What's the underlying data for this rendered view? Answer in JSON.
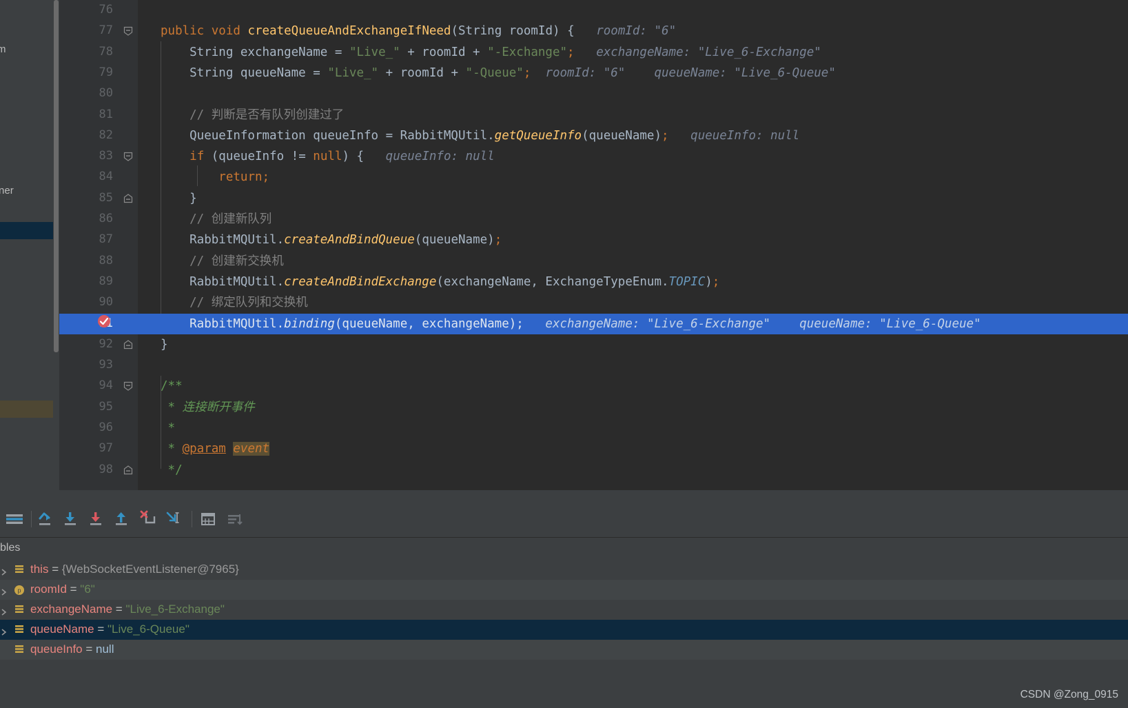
{
  "editor": {
    "first_line": 76,
    "lines": [
      {
        "num": 76,
        "tokens": [],
        "fold": null
      },
      {
        "num": 77,
        "fold": "minus",
        "tokens": [
          {
            "t": "public ",
            "c": "kw"
          },
          {
            "t": "void ",
            "c": "kw"
          },
          {
            "t": "createQueueAndExchangeIfNeed",
            "c": "fn"
          },
          {
            "t": "(",
            "c": "id"
          },
          {
            "t": "String",
            "c": "id"
          },
          {
            "t": " roomId",
            "c": "id"
          },
          {
            "t": ") {",
            "c": "id"
          },
          {
            "t": "   roomId: \"6\"",
            "c": "hint"
          }
        ]
      },
      {
        "num": 78,
        "fold": null,
        "tokens": [
          {
            "t": "    String exchangeName = ",
            "c": "id"
          },
          {
            "t": "\"Live_\"",
            "c": "str"
          },
          {
            "t": " + roomId + ",
            "c": "id"
          },
          {
            "t": "\"-Exchange\"",
            "c": "str"
          },
          {
            "t": ";",
            "c": "kw"
          },
          {
            "t": "   exchangeName: \"Live_6-Exchange\"",
            "c": "hint"
          }
        ]
      },
      {
        "num": 79,
        "fold": null,
        "tokens": [
          {
            "t": "    String queueName = ",
            "c": "id"
          },
          {
            "t": "\"Live_\"",
            "c": "str"
          },
          {
            "t": " + roomId + ",
            "c": "id"
          },
          {
            "t": "\"-Queue\"",
            "c": "str"
          },
          {
            "t": ";",
            "c": "kw"
          },
          {
            "t": "  roomId: \"6\"    queueName: \"Live_6-Queue\"",
            "c": "hint"
          }
        ]
      },
      {
        "num": 80,
        "fold": null,
        "tokens": []
      },
      {
        "num": 81,
        "fold": null,
        "tokens": [
          {
            "t": "    // 判断是否有队列创建过了",
            "c": "com"
          }
        ]
      },
      {
        "num": 82,
        "fold": null,
        "tokens": [
          {
            "t": "    QueueInformation queueInfo = RabbitMQUtil.",
            "c": "id"
          },
          {
            "t": "getQueueInfo",
            "c": "fn it"
          },
          {
            "t": "(queueName)",
            "c": "id"
          },
          {
            "t": ";",
            "c": "kw"
          },
          {
            "t": "   queueInfo: null",
            "c": "hint"
          }
        ]
      },
      {
        "num": 83,
        "fold": "minus",
        "tokens": [
          {
            "t": "    ",
            "c": "id"
          },
          {
            "t": "if",
            "c": "kw"
          },
          {
            "t": " (queueInfo != ",
            "c": "id"
          },
          {
            "t": "null",
            "c": "kw"
          },
          {
            "t": ") {",
            "c": "id"
          },
          {
            "t": "   queueInfo: null",
            "c": "hint"
          }
        ]
      },
      {
        "num": 84,
        "fold": null,
        "tokens": [
          {
            "t": "        ",
            "c": "id"
          },
          {
            "t": "return",
            "c": "kw"
          },
          {
            "t": ";",
            "c": "kw"
          }
        ]
      },
      {
        "num": 85,
        "fold": "angle",
        "tokens": [
          {
            "t": "    }",
            "c": "id"
          }
        ]
      },
      {
        "num": 86,
        "fold": null,
        "tokens": [
          {
            "t": "    // 创建新队列",
            "c": "com"
          }
        ]
      },
      {
        "num": 87,
        "fold": null,
        "tokens": [
          {
            "t": "    RabbitMQUtil.",
            "c": "id"
          },
          {
            "t": "createAndBindQueue",
            "c": "fn it"
          },
          {
            "t": "(queueName)",
            "c": "id"
          },
          {
            "t": ";",
            "c": "kw"
          }
        ]
      },
      {
        "num": 88,
        "fold": null,
        "tokens": [
          {
            "t": "    // 创建新交换机",
            "c": "com"
          }
        ]
      },
      {
        "num": 89,
        "fold": null,
        "tokens": [
          {
            "t": "    RabbitMQUtil.",
            "c": "id"
          },
          {
            "t": "createAndBindExchange",
            "c": "fn it"
          },
          {
            "t": "(exchangeName, ExchangeTypeEnum.",
            "c": "id"
          },
          {
            "t": "TOPIC",
            "c": "num it"
          },
          {
            "t": ")",
            "c": "id"
          },
          {
            "t": ";",
            "c": "kw"
          }
        ]
      },
      {
        "num": 90,
        "fold": null,
        "tokens": [
          {
            "t": "    // 绑定队列和交换机",
            "c": "com"
          }
        ]
      },
      {
        "num": 91,
        "fold": null,
        "highlight": true,
        "tokens": [
          {
            "t": "    RabbitMQUtil.",
            "c": "sel-txt"
          },
          {
            "t": "binding",
            "c": "sel-txt it"
          },
          {
            "t": "(queueName, exchangeName);",
            "c": "sel-txt"
          },
          {
            "t": "   exchangeName: \"Live_6-Exchange\"    queueName: \"Live_6-Queue\"",
            "c": "hint-on-sel"
          }
        ]
      },
      {
        "num": 92,
        "fold": "angle",
        "tokens": [
          {
            "t": "}",
            "c": "id"
          }
        ]
      },
      {
        "num": 93,
        "fold": null,
        "tokens": []
      },
      {
        "num": 94,
        "fold": "minus",
        "tokens": [
          {
            "t": "/**",
            "c": "doc"
          }
        ]
      },
      {
        "num": 95,
        "fold": null,
        "tokens": [
          {
            "t": " * ",
            "c": "doc"
          },
          {
            "t": "连接断开事件",
            "c": "doc it"
          }
        ]
      },
      {
        "num": 96,
        "fold": null,
        "tokens": [
          {
            "t": " *",
            "c": "doc"
          }
        ]
      },
      {
        "num": 97,
        "fold": null,
        "tokens": [
          {
            "t": " * ",
            "c": "doc"
          },
          {
            "t": "@param",
            "c": "doctag"
          },
          {
            "t": " ",
            "c": "doc"
          },
          {
            "t": "event",
            "c": "docparam"
          }
        ]
      },
      {
        "num": 98,
        "fold": "angle",
        "tokens": [
          {
            "t": " */",
            "c": "doc"
          }
        ]
      }
    ]
  },
  "left_fragment": {
    "top_text": "m",
    "mid_text": "stener"
  },
  "debug": {
    "toolbar": [
      {
        "name": "show-execution-point-icon",
        "label": "Show Execution Point"
      },
      {
        "name": "step-over-icon",
        "label": "Step Over"
      },
      {
        "name": "step-into-icon",
        "label": "Step Into"
      },
      {
        "name": "force-step-into-icon",
        "label": "Force Step Into"
      },
      {
        "name": "step-out-icon",
        "label": "Step Out"
      },
      {
        "name": "drop-frame-icon",
        "label": "Drop Frame"
      },
      {
        "name": "run-to-cursor-icon",
        "label": "Run to Cursor"
      },
      {
        "name": "evaluate-expression-icon",
        "label": "Evaluate Expression"
      },
      {
        "name": "settings-lines-icon",
        "label": "Layout Settings"
      }
    ],
    "variables_tab_label": "bles",
    "variables": [
      {
        "name": "this",
        "eq": " = ",
        "value": "{WebSocketEventListener@7965}",
        "value_class": "v-obj",
        "icon": "field-icon",
        "expandable": true,
        "selected": false,
        "alt": false
      },
      {
        "name": "roomId",
        "eq": " = ",
        "value": "\"6\"",
        "value_class": "v-str",
        "icon": "parameter-icon",
        "expandable": true,
        "selected": false,
        "alt": true
      },
      {
        "name": "exchangeName",
        "eq": " = ",
        "value": "\"Live_6-Exchange\"",
        "value_class": "v-str",
        "icon": "field-icon",
        "expandable": true,
        "selected": false,
        "alt": false
      },
      {
        "name": "queueName",
        "eq": " = ",
        "value": "\"Live_6-Queue\"",
        "value_class": "v-str",
        "icon": "field-icon",
        "expandable": true,
        "selected": true,
        "alt": false
      },
      {
        "name": "queueInfo",
        "eq": " = ",
        "value": "null",
        "value_class": "v-null",
        "icon": "field-icon",
        "expandable": false,
        "selected": false,
        "alt": true
      }
    ]
  },
  "watermark": "CSDN @Zong_0915",
  "colors": {
    "editor_bg": "#2b2b2b",
    "gutter_bg": "#313335",
    "panel_bg": "#3c3f41",
    "selection_blue": "#2f65ca",
    "row_select": "#0d293e",
    "keyword": "#cc7832",
    "string": "#6a8759",
    "method": "#ffc66d",
    "comment": "#808080",
    "javadoc": "#629755"
  }
}
